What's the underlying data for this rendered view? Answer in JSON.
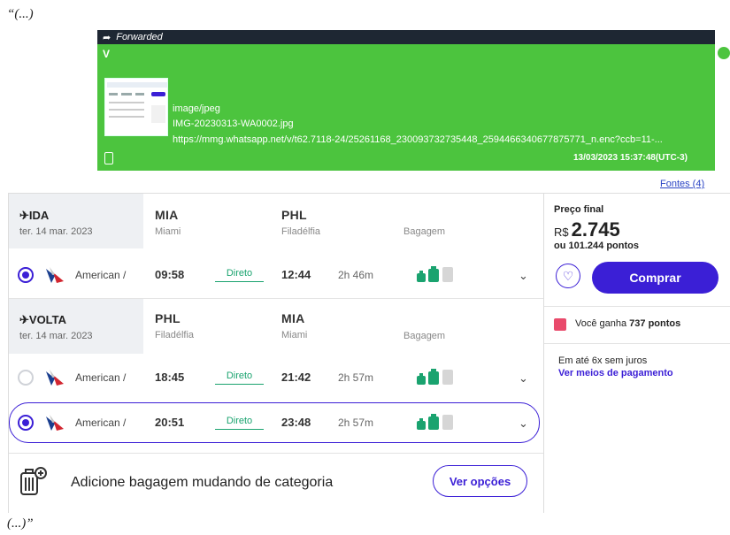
{
  "quote_open": "“(...)",
  "quote_close": "(...)”",
  "whatsapp": {
    "forwarded_label": "Forwarded",
    "sender": "V",
    "mime": "image/jpeg",
    "filename": "IMG-20230313-WA0002.jpg",
    "url": "https://mmg.whatsapp.net/v/t62.7118-24/25261168_230093732735448_2594466340677875771_n.enc?ccb=11-...",
    "timestamp": "13/03/2023 15:37:48(UTC-3)"
  },
  "fontes_link": "Fontes (4)",
  "ida": {
    "label": "✈IDA",
    "date": "ter. 14 mar. 2023",
    "from_code": "MIA",
    "from_city": "Miami",
    "to_code": "PHL",
    "to_city": "Filadélfia",
    "bag_header": "Bagagem",
    "flights": [
      {
        "airline": "American /",
        "dep": "09:58",
        "stops": "Direto",
        "arr": "12:44",
        "duration": "2h 46m",
        "selected": true
      }
    ]
  },
  "volta": {
    "label": "✈VOLTA",
    "date": "ter. 14 mar. 2023",
    "from_code": "PHL",
    "from_city": "Filadélfia",
    "to_code": "MIA",
    "to_city": "Miami",
    "bag_header": "Bagagem",
    "flights": [
      {
        "airline": "American /",
        "dep": "18:45",
        "stops": "Direto",
        "arr": "21:42",
        "duration": "2h 57m",
        "selected": false
      },
      {
        "airline": "American /",
        "dep": "20:51",
        "stops": "Direto",
        "arr": "23:48",
        "duration": "2h 57m",
        "selected": true
      }
    ]
  },
  "baggage_cta": {
    "text": "Adicione bagagem mudando de categoria",
    "button": "Ver opções"
  },
  "price": {
    "label": "Preço final",
    "currency": "R$",
    "value": "2.745",
    "points": "ou 101.244 pontos",
    "buy": "Comprar",
    "earn_prefix": "Você ganha ",
    "earn_points": "737 pontos",
    "installments": "Em até 6x sem juros",
    "payment_link": "Ver meios de pagamento"
  },
  "colors": {
    "brand": "#3b1fd6",
    "whatsapp_green": "#4cc43e",
    "direct_green": "#1aa36f"
  }
}
